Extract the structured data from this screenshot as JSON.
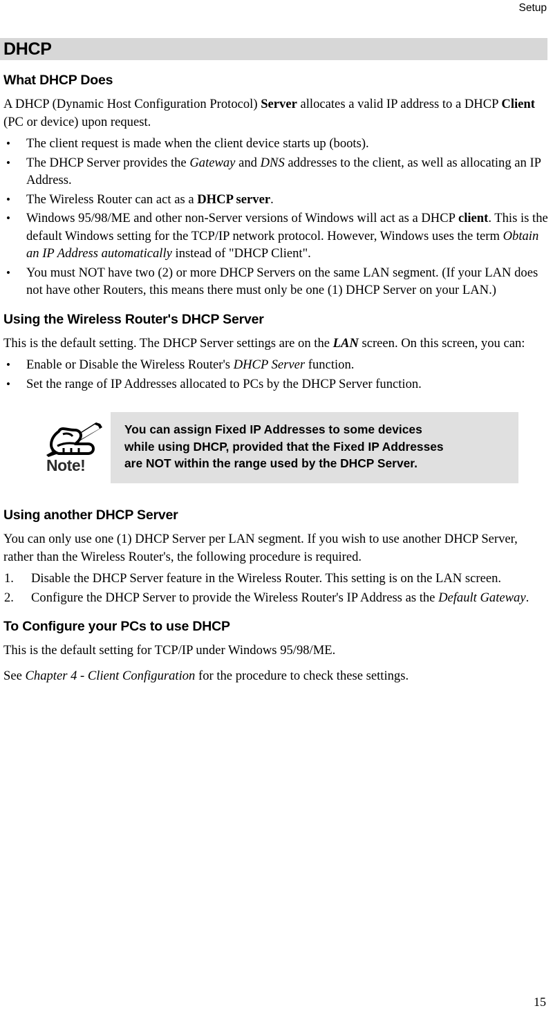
{
  "header": {
    "running_title": "Setup"
  },
  "banner": {
    "chapter_title": "DHCP",
    "background_color": "#d7d7d7"
  },
  "sections": {
    "what_dhcp_does": {
      "heading": "What DHCP Does",
      "intro_parts": {
        "p1_a": "A DHCP (Dynamic Host Configuration Protocol) ",
        "p1_b": "Server",
        "p1_c": " allocates a valid IP address to a DHCP ",
        "p1_d": "Client",
        "p1_e": " (PC or device) upon request."
      },
      "bullets": {
        "b1": "The client request is made when the client device starts up (boots).",
        "b2_a": "The DHCP Server provides the ",
        "b2_b": "Gateway",
        "b2_c": " and ",
        "b2_d": "DNS",
        "b2_e": " addresses to the client, as well as allocating an IP Address.",
        "b3_a": "The Wireless Router can act as a ",
        "b3_b": "DHCP server",
        "b3_c": ".",
        "b4_a": "Windows 95/98/ME and other non-Server versions of Windows will act as a DHCP ",
        "b4_b": "client",
        "b4_c": ". This is the default Windows setting for the TCP/IP network protocol. However, Windows uses the term ",
        "b4_d": "Obtain an IP Address automatically",
        "b4_e": " instead of \"DHCP Client\".",
        "b5": "You must NOT have two (2) or more DHCP Servers on the same LAN segment. (If your LAN does not have other Routers, this means there must only be one (1) DHCP Server on your LAN.)"
      },
      "bullet_marker": "•"
    },
    "using_router_dhcp": {
      "heading": "Using the Wireless Router's DHCP Server",
      "intro_a": "This is the default setting. The DHCP Server settings are on the ",
      "intro_b": "LAN",
      "intro_c": " screen. On this screen, you can:",
      "bullets": {
        "b1_a": "Enable or Disable the Wireless Router's ",
        "b1_b": "DHCP Server",
        "b1_c": " function.",
        "b2": "Set the range of IP Addresses allocated to PCs by the DHCP Server function."
      }
    },
    "note": {
      "icon_label": "Note!",
      "lines": [
        "You can assign Fixed IP Addresses to some devices",
        "while using DHCP, provided that the Fixed IP Addresses",
        "are NOT within the range used by the DHCP Server."
      ],
      "background_color": "#e0e0e0"
    },
    "using_another_dhcp": {
      "heading": "Using another DHCP Server",
      "intro": "You can only use one (1) DHCP Server per LAN segment. If you wish to use another DHCP Server, rather than the Wireless Router's, the following procedure is required.",
      "steps": {
        "s1_marker": "1.",
        "s1": "Disable the DHCP Server feature in the Wireless Router. This setting is on the LAN screen.",
        "s2_marker": "2.",
        "s2_a": "Configure the DHCP Server to provide the Wireless Router's IP Address as the ",
        "s2_b": "Default Gateway",
        "s2_c": "."
      }
    },
    "configure_pcs": {
      "heading": "To Configure your PCs to use DHCP",
      "p1": "This is the default setting for TCP/IP under Windows 95/98/ME.",
      "p2_a": "See ",
      "p2_b": "Chapter 4 - Client Configuration",
      "p2_c": " for the procedure to check these settings."
    }
  },
  "footer": {
    "page_number": "15"
  }
}
